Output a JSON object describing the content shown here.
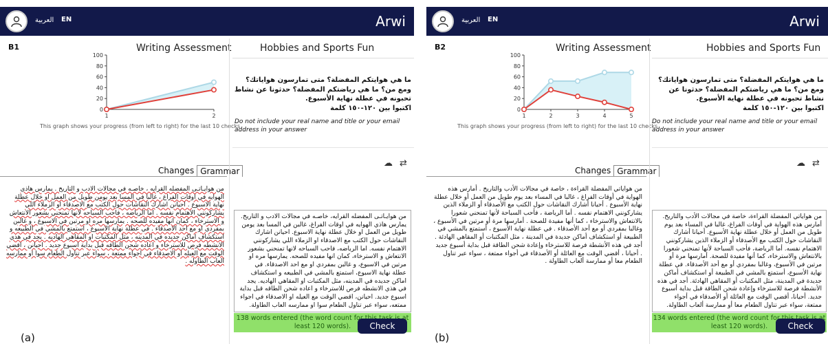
{
  "brand": "Arwi",
  "lang_ar": "العربية",
  "lang_en": "EN",
  "assessment_title": "Writing Assessment",
  "task_title": "Hobbies and Sports Fun",
  "caption": "This graph shows your progress (from left to right) for the last 10 checks",
  "tabs": [
    "Changes",
    "Grammar"
  ],
  "prompt_ar": "ما هي هوايتكم المفضلة؟ متى تمارسون هواياتك؟ ومع من؟ ما هي رياضتكم المفضلة؟ حدثونا عن نشاط تحبونه في عطلة نهاية الأسبوع.",
  "prompt_ar_2": "اكتبوا بين ١٢٠-١٥٠ كلمة",
  "prompt_en": "Do not include your real name and title or your email address in your answer",
  "check_label": "Check",
  "chart_colors": {
    "upper": "#add8e6",
    "lower": "#e0403a",
    "fill": "#d8f1f7"
  },
  "panels": [
    {
      "label": "(a)",
      "level": "B1",
      "chart_data": {
        "type": "line",
        "x": [
          1,
          2
        ],
        "ylim": [
          0,
          100
        ],
        "yticks": [
          0,
          20,
          40,
          60,
          80,
          100
        ],
        "series": [
          {
            "values": [
              0,
              50
            ]
          },
          {
            "values": [
              0,
              36
            ]
          }
        ]
      },
      "feedback_text": "من هوايـاتـى المفضله القرايه ، خاصـه في مجالات الادب و التاريخ . يمارس هاذي الهوايه في اوقات الفراغ ، غالبا في المسا بعد يومن طويل من العمل او خلال عطلة نهاية الاسبوع . احيانن اشارك النقاشات حول الكتب مع الاصدقاء او الزملاء اللي يشاركونني الاهتمام نفسه . اما الرياضه ، فاحب السباحه لانها تمنحني بشعور الانتعاش و الاسترخاء ، كمان انها مفيده للصحه . يمارسها مره او مرتين في الاسبوع ، و غالبن بمفردي او مع احد الاصدقاء . في عطلة نهاية الاسبوع ، استمتع بالمشي في الطبيعه و استكشاف اماكن جديده في المدينه ، مثل المكتبات او المقاهي الهاديه . يجد في هذي الانشطه فرص للاسترخاء و اعاده شحن الطاقه قبل بداية اسبوع جديد . احيانن ، اقضي الوقت مع العيله او الاصدقاء في اجواء ممتعة ، سواء عبر تناول الطعام سوا او ممارسه العاب الطاوله .",
      "essay_text": "من هوايـاتـى المفضله القرايه، خاصـه في مجالات الادب و التاريخ. يمارس هاذي الهوايه في اوقات الفراغ، غالبن في المسا بعد يومن طويل من العمل او خلال عطلة نهاية الاسبوع. احيانن اشارك النقاشات حول الكتب مع الاصدقاء او الزملاء اللي يشاركونني الاهتمام نفسه. اما الرياضه، فاحب السباحه لانها تمنحني بشعور الانتعاش و الاسترخاء، كمان انها مفيده للصحه. يمارسها مره او مرتين في الاسبوع، و غالبن بمفردي او مع احد الاصدقاء. في عطلة نهاية الاسبوع، استمتع بالمشي في الطبيعه و استكشاف اماكن جديده في المدينه، مثل المكتبات او المقاهي الهاديه. يجد في هذي الانشطه فرص للاسترخاء و اعاده شحن الطاقه قبل بداية اسبوع جديد. احيانن، اقضي الوقت مع العيله او الاصدقاء في اجواء ممتعه، سواء عبر تناول الطعام سوا او ممارسه العاب الطاولة.",
      "word_count": "138 words entered (the word count for this task is at least 120 words)."
    },
    {
      "label": "(b)",
      "level": "B2",
      "chart_data": {
        "type": "line",
        "x": [
          1,
          2,
          3,
          4,
          5
        ],
        "ylim": [
          0,
          100
        ],
        "yticks": [
          0,
          20,
          40,
          60,
          80,
          100
        ],
        "series": [
          {
            "values": [
              0,
              52,
              52,
              68,
              68
            ]
          },
          {
            "values": [
              0,
              36,
              24,
              13,
              0
            ]
          }
        ]
      },
      "feedback_text": "من هواياتي المفضلة القراءة ، خاصة في مجالات الأدب والتاريخ . أمارس هذه الهواية في أوقات الفراغ ، غالبا في المساء بعد يوم طويل من العمل أو خلال عطلة نهاية الأسبوع . أحيانا أشارك النقاشات حول الكتب مع الأصدقاء أو الزملاء الذين يشاركونني الاهتمام نفسه . أما الرياضة ، فأحب السباحة لأنها تمنحني شعورا بالانتعاش والاسترخاء ، كما أنها مفيدة للصحة . أمارسها مرة أو مرتين في الأسبوع ، وغالبا بمفردي أو مع أحد الأصدقاء . في عطلة نهاية الأسبوع ، أستمتع بالمشي في الطبيعة أو استكشاف أماكن جديدة في المدينة ، مثل المكتبات أو المقاهي الهادئة . أجد في هذه الأنشطة فرصة للاسترخاء وإعادة شحن الطاقة قبل بداية أسبوع جديد . أحيانا ، أقضي الوقت مع العائلة أو الأصدقاء في أجواء ممتعة ، سواء عبر تناول الطعام معا أو ممارسة ألعاب الطاولة .",
      "essay_text": "من هواياتي المفضلة القراءة، خاصة في مجالات الأدب والتاريخ. أمارس هذه الهواية في أوقات الفراغ، غالبا في المساء بعد يوم طويل من العمل أو خلال عطلة نهاية الأسبوع. أحيانا أشارك النقاشات حول الكتب مع الأصدقاء أو الزملاء الذين يشاركونني الاهتمام نفسه. أما الرياضة، فأحب السباحة لأنها تمنحني شعورا بالانتعاش والاسترخاء، كما أنها مفيدة للصحة. أمارسها مرة أو مرتين في الأسبوع، وغالبا بمفردي أو مع أحد الأصدقاء. في عطلة نهاية الأسبوع، أستمتع بالمشي في الطبيعة أو استكشاف أماكن جديدة في المدينة، مثل المكتبات أو المقاهي الهادئة. أجد في هذه الأنشطة فرصة للاسترخاء وإعادة شحن الطاقة قبل بداية أسبوع جديد. أحيانا، أقضي الوقت مع العائلة أو الأصدقاء في أجواء ممتعة، سواء عبر تناول الطعام معا أو ممارسة ألعاب الطاولة.",
      "word_count": "134 words entered (the word count for this task is at least 120 words)."
    }
  ]
}
